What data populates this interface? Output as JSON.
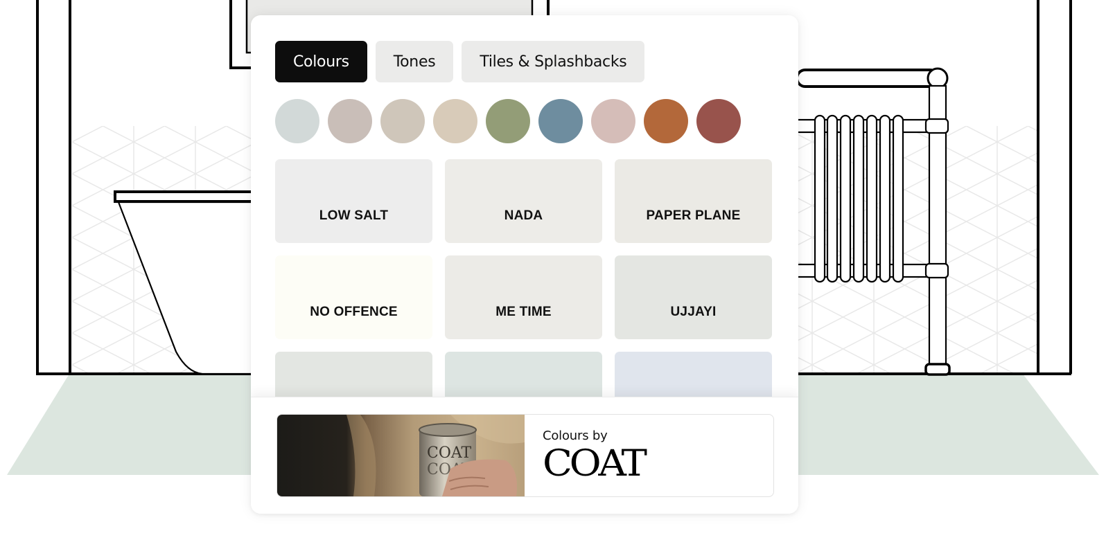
{
  "tabs": [
    {
      "label": "Colours",
      "active": true
    },
    {
      "label": "Tones",
      "active": false
    },
    {
      "label": "Tiles & Splashbacks",
      "active": false
    }
  ],
  "swatches": [
    {
      "name": "pale-grey-blue",
      "color": "#d2d9d8"
    },
    {
      "name": "warm-grey",
      "color": "#c9beb8"
    },
    {
      "name": "stone",
      "color": "#cfc6ba"
    },
    {
      "name": "sand",
      "color": "#d8cbb9"
    },
    {
      "name": "sage-green",
      "color": "#939d77"
    },
    {
      "name": "dusty-blue",
      "color": "#6e8d9f"
    },
    {
      "name": "blush",
      "color": "#d5bdb8"
    },
    {
      "name": "terracotta",
      "color": "#b3683a"
    },
    {
      "name": "brick-red",
      "color": "#98534c"
    }
  ],
  "colour_tiles": [
    {
      "label": "LOW SALT",
      "color": "#ededed"
    },
    {
      "label": "NADA",
      "color": "#edece8"
    },
    {
      "label": "PAPER PLANE",
      "color": "#ebeae5"
    },
    {
      "label": "NO OFFENCE",
      "color": "#fdfdf6"
    },
    {
      "label": "ME TIME",
      "color": "#ecebe7"
    },
    {
      "label": "UJJAYI",
      "color": "#e4e6e2"
    },
    {
      "label": "",
      "color": "#e3e6e2"
    },
    {
      "label": "",
      "color": "#dde5e2"
    },
    {
      "label": "",
      "color": "#e0e5ed"
    }
  ],
  "promo": {
    "subtitle": "Colours by",
    "brand": "COAT",
    "image_alt": "hands holding COAT paint tin"
  },
  "scene": {
    "floor_color": "#dce6df",
    "tile_line_color": "#e8e8e8"
  }
}
